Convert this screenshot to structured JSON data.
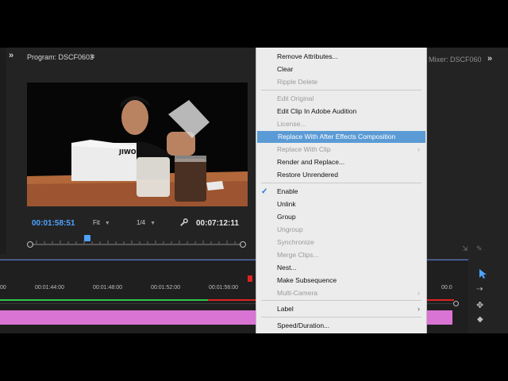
{
  "program_monitor": {
    "title": "Program: DSCF0603",
    "menu_icon": "≡",
    "current_time": "00:01:58:51",
    "zoom": "Fit",
    "resolution": "1/4",
    "duration": "00:07:12:11",
    "video_sign": "JIWO"
  },
  "right_panel": {
    "title": "Mixer: DSCF060"
  },
  "timeline": {
    "ticks": [
      "00",
      "00:01:44:00",
      "00:01:48:00",
      "00:01:52:00",
      "00:01:56:00",
      "00:0"
    ]
  },
  "context_menu": {
    "items": [
      {
        "label": "Remove Attributes...",
        "enabled": true
      },
      {
        "label": "Clear",
        "enabled": true
      },
      {
        "label": "Ripple Delete",
        "enabled": false
      },
      {
        "label": "Edit Original",
        "enabled": false
      },
      {
        "label": "Edit Clip In Adobe Audition",
        "enabled": true
      },
      {
        "label": "License...",
        "enabled": false
      },
      {
        "label": "Replace With After Effects Composition",
        "enabled": true,
        "highlighted": true
      },
      {
        "label": "Replace With Clip",
        "enabled": false,
        "submenu": true
      },
      {
        "label": "Render and Replace...",
        "enabled": true
      },
      {
        "label": "Restore Unrendered",
        "enabled": true
      },
      {
        "label": "Enable",
        "enabled": true,
        "checked": true
      },
      {
        "label": "Unlink",
        "enabled": true
      },
      {
        "label": "Group",
        "enabled": true
      },
      {
        "label": "Ungroup",
        "enabled": false
      },
      {
        "label": "Synchronize",
        "enabled": false
      },
      {
        "label": "Merge Clips...",
        "enabled": false
      },
      {
        "label": "Nest...",
        "enabled": true
      },
      {
        "label": "Make Subsequence",
        "enabled": true
      },
      {
        "label": "Multi-Camera",
        "enabled": false,
        "submenu": true
      },
      {
        "label": "Label",
        "enabled": true,
        "submenu": true
      },
      {
        "label": "Speed/Duration...",
        "enabled": true
      }
    ]
  },
  "colors": {
    "accent_blue": "#4ea3ff",
    "menu_highlight": "#5b9bd5",
    "clip_pink": "#d974d4",
    "render_green": "#2ec64a",
    "render_red": "#dd2222"
  }
}
